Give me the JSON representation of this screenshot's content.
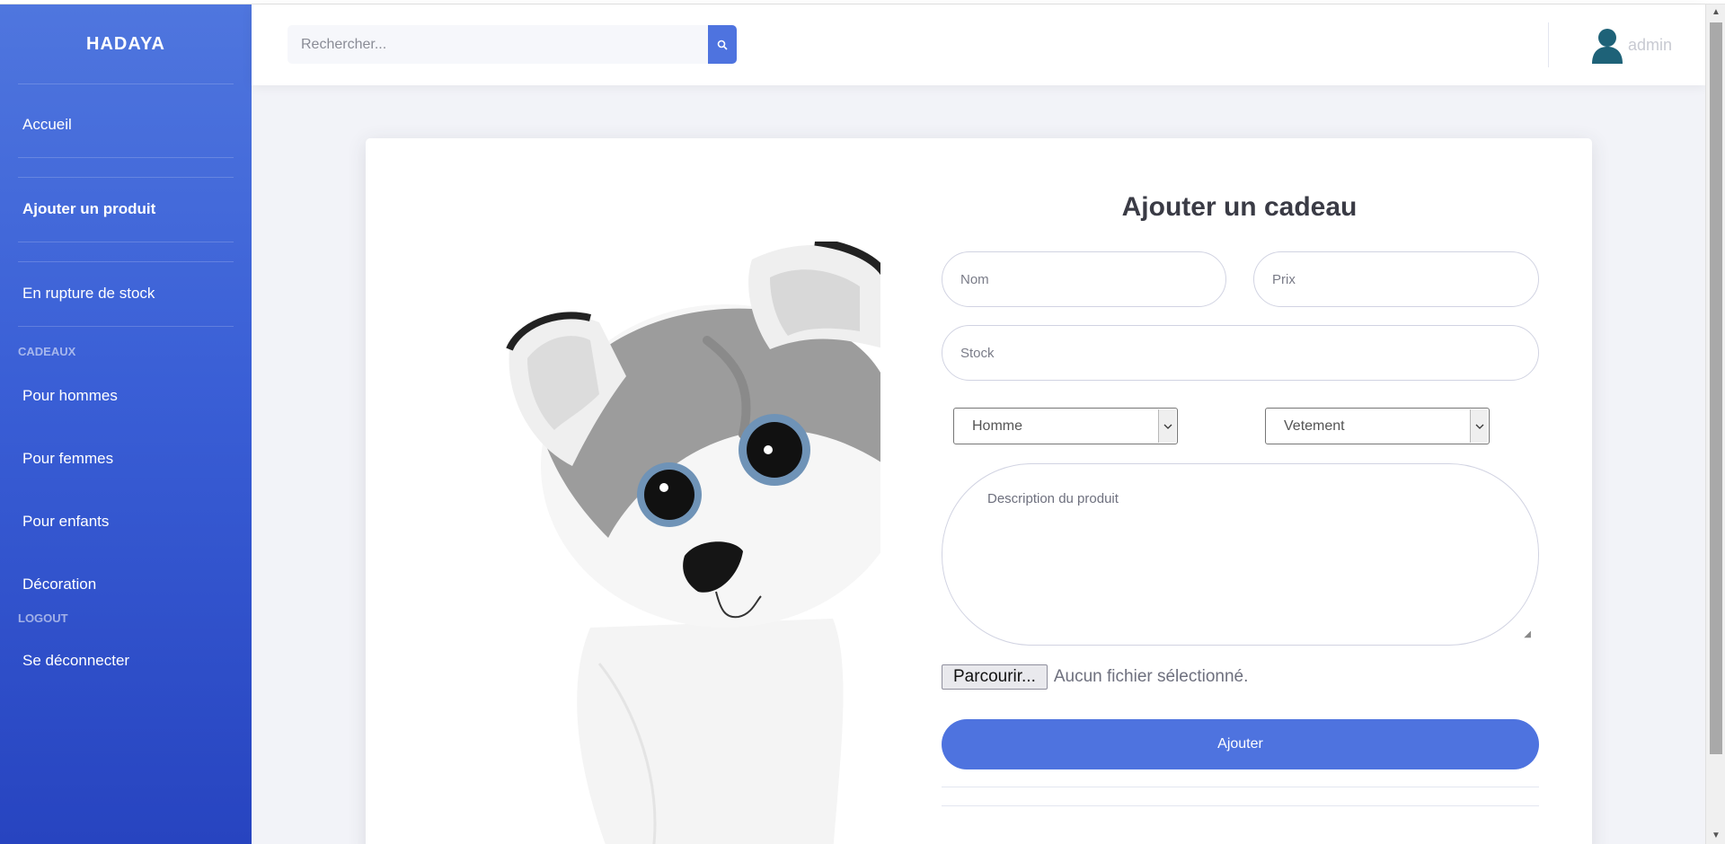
{
  "brand": "HADAYA",
  "sidebar": {
    "home": "Accueil",
    "add_product": "Ajouter un produit",
    "out_of_stock": "En rupture de stock",
    "section_gifts": "CADEAUX",
    "for_men": "Pour hommes",
    "for_women": "Pour femmes",
    "for_kids": "Pour enfants",
    "decoration": "Décoration",
    "section_logout": "LOGOUT",
    "logout": "Se déconnecter"
  },
  "search": {
    "placeholder": "Rechercher..."
  },
  "user": {
    "name": "admin"
  },
  "form": {
    "title": "Ajouter un cadeau",
    "name_placeholder": "Nom",
    "price_placeholder": "Prix",
    "stock_placeholder": "Stock",
    "gender_selected": "Homme",
    "category_selected": "Vetement",
    "description_placeholder": "Description du produit",
    "file_button": "Parcourir...",
    "file_status": "Aucun fichier sélectionné.",
    "submit": "Ajouter"
  },
  "colors": {
    "primary": "#4e73df",
    "sidebar_top": "#4f76de",
    "sidebar_bottom": "#2744c0"
  }
}
